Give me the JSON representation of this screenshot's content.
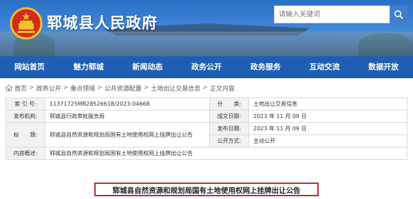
{
  "header": {
    "site_title": "郓城县人民政府",
    "search_placeholder": "请输入关键词"
  },
  "nav": [
    "网站首页",
    "魅力郓城",
    "新闻动态",
    "政务公开",
    "政务服务",
    "互动交流",
    "数据开放"
  ],
  "breadcrumb": [
    "首页",
    "政务公开",
    "重点领域",
    "公共资源配置",
    "土地出让交易信息",
    "正文内容"
  ],
  "info": {
    "index_label": "索 引 号:",
    "index_value": "11371725MB2852661B/2023-04668",
    "category_label": "分　　类:",
    "category_value": "土地出让交易信息",
    "publisher_label": "发布机构:",
    "publisher_value": "郓城县行政审批服务局",
    "created_label": "成文日期:",
    "created_value": "2023 年 11 月 09 日",
    "published_label": "发布日期:",
    "published_value": "2023 年 11 月 09 日",
    "title_label": "标　　题:",
    "title_value": "郓城县自然资源和规划局国有土地使用权网上挂牌出让公告",
    "open_label": "公开方式:",
    "open_value": "主动公开",
    "summary_label": "内容概述:",
    "summary_value": "郓城县自然资源和规划局国有土地使用权网上挂牌出让公告"
  },
  "doc_title": "郓城县自然资源和规划局国有土地使用权网上挂牌出让公告",
  "colors": {
    "nav_bg": "#1f5fb3",
    "title_border": "#c0262b"
  }
}
